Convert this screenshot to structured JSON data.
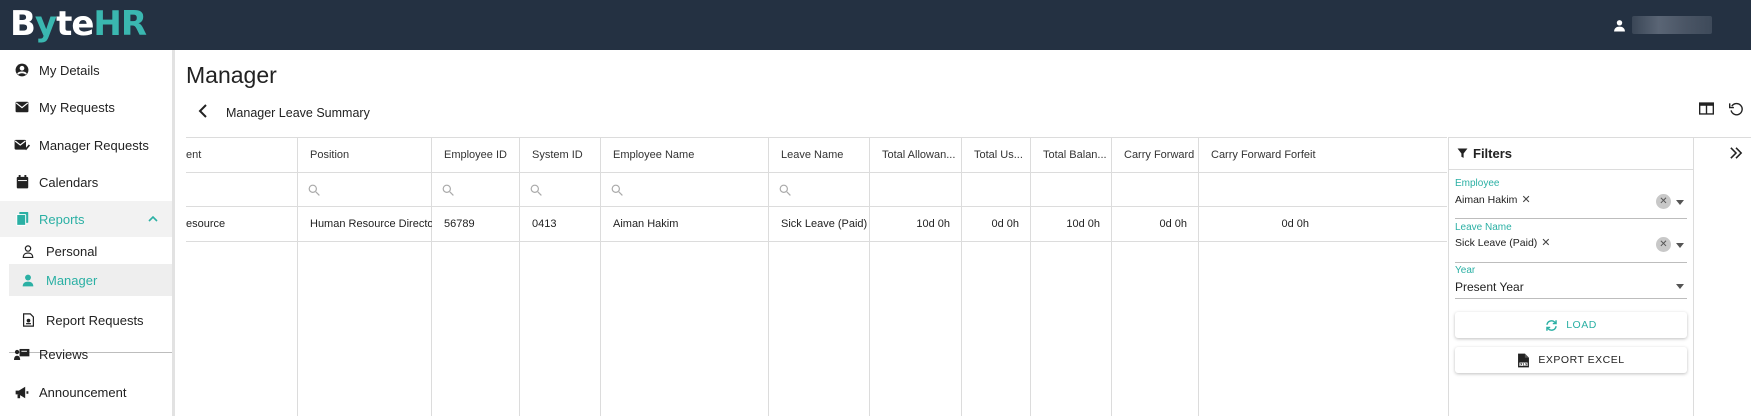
{
  "brand": {
    "logo_part1": "B",
    "logo_part2": "y",
    "logo_part3": "te",
    "logo_part4": "HR",
    "accent": "#3ab7b0",
    "topbar_color": "#243142"
  },
  "sidebar": {
    "items": [
      {
        "label": "My Details",
        "icon": "account-circle-icon"
      },
      {
        "label": "My Requests",
        "icon": "envelope-icon"
      },
      {
        "label": "Manager Requests",
        "icon": "envelope-check-icon"
      },
      {
        "label": "Calendars",
        "icon": "calendar-icon"
      },
      {
        "label": "Reports",
        "icon": "documents-icon"
      },
      {
        "label": "Personal",
        "icon": "person-outline-icon"
      },
      {
        "label": "Manager",
        "icon": "person-filled-icon"
      },
      {
        "label": "Report Requests",
        "icon": "file-report-icon"
      },
      {
        "label": "Reviews",
        "icon": "presentation-icon"
      },
      {
        "label": "Announcement",
        "icon": "megaphone-icon"
      }
    ]
  },
  "main": {
    "title": "Manager",
    "subtitle": "Manager Leave Summary"
  },
  "table": {
    "headers": [
      "ent",
      "Position",
      "Employee ID",
      "System ID",
      "Employee Name",
      "Leave Name",
      "Total Allowan...",
      "Total Us...",
      "Total Balan...",
      "Carry Forward",
      "Carry Forward Forfeit"
    ],
    "row": [
      "esource",
      "Human Resource Director",
      "56789",
      "0413",
      "Aiman Hakim",
      "Sick Leave (Paid)",
      "10d 0h",
      "0d 0h",
      "10d 0h",
      "0d 0h",
      "0d 0h"
    ]
  },
  "filters": {
    "title": "Filters",
    "employee_label": "Employee",
    "employee_value": "Aiman Hakim",
    "leave_label": "Leave Name",
    "leave_value": "Sick Leave (Paid)",
    "year_label": "Year",
    "year_value": "Present Year",
    "load_label": "LOAD",
    "export_label": "EXPORT EXCEL"
  }
}
